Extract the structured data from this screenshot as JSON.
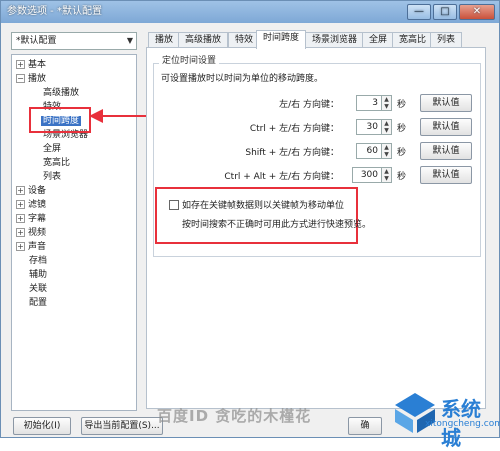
{
  "window": {
    "title": "参数选项 - *默认配置",
    "minimize": "—",
    "maximize": "□",
    "close": "✕"
  },
  "sidebar": {
    "preset": "*默认配置",
    "tree": [
      {
        "label": "基本",
        "expander": "+"
      },
      {
        "label": "播放",
        "expander": "−"
      },
      {
        "label": "高级播放"
      },
      {
        "label": "特效"
      },
      {
        "label": "时间跨度",
        "selected": true
      },
      {
        "label": "场景浏览器"
      },
      {
        "label": "全屏"
      },
      {
        "label": "宽高比"
      },
      {
        "label": "列表"
      },
      {
        "label": "设备",
        "expander": "+"
      },
      {
        "label": "滤镜",
        "expander": "+"
      },
      {
        "label": "字幕",
        "expander": "+"
      },
      {
        "label": "视频",
        "expander": "+"
      },
      {
        "label": "声音",
        "expander": "+"
      },
      {
        "label": "存档"
      },
      {
        "label": "辅助"
      },
      {
        "label": "关联"
      },
      {
        "label": "配置"
      }
    ]
  },
  "footer": {
    "reset": "初始化(I)",
    "export": "导出当前配置(S)...",
    "ok": "确"
  },
  "tabs": [
    "播放",
    "高级播放",
    "特效",
    "时间跨度",
    "场景浏览器",
    "全屏",
    "宽高比",
    "列表"
  ],
  "panel": {
    "group_title": "定位时间设置",
    "description": "可设置播放时以时间为单位的移动跨度。",
    "rows": [
      {
        "label": "左/右 方向键：",
        "value": "3",
        "unit": "秒",
        "default": "默认值"
      },
      {
        "label": "Ctrl + 左/右 方向键：",
        "value": "30",
        "unit": "秒",
        "default": "默认值"
      },
      {
        "label": "Shift + 左/右 方向键：",
        "value": "60",
        "unit": "秒",
        "default": "默认值"
      },
      {
        "label": "Ctrl + Alt + 左/右 方向键：",
        "value": "300",
        "unit": "秒",
        "default": "默认值"
      }
    ],
    "checkbox_label": "如存在关键帧数据则以关键帧为移动单位",
    "checkbox_note": "按时间搜索不正确时可用此方式进行快速预览。",
    "checkbox_checked": false
  },
  "watermark": {
    "text": "百度ID 贪吃的木槿花",
    "site": "系统城",
    "url": "xitongcheng.com"
  },
  "colors": {
    "annotation_red": "#e8303b",
    "selection_blue": "#3b73c5"
  }
}
